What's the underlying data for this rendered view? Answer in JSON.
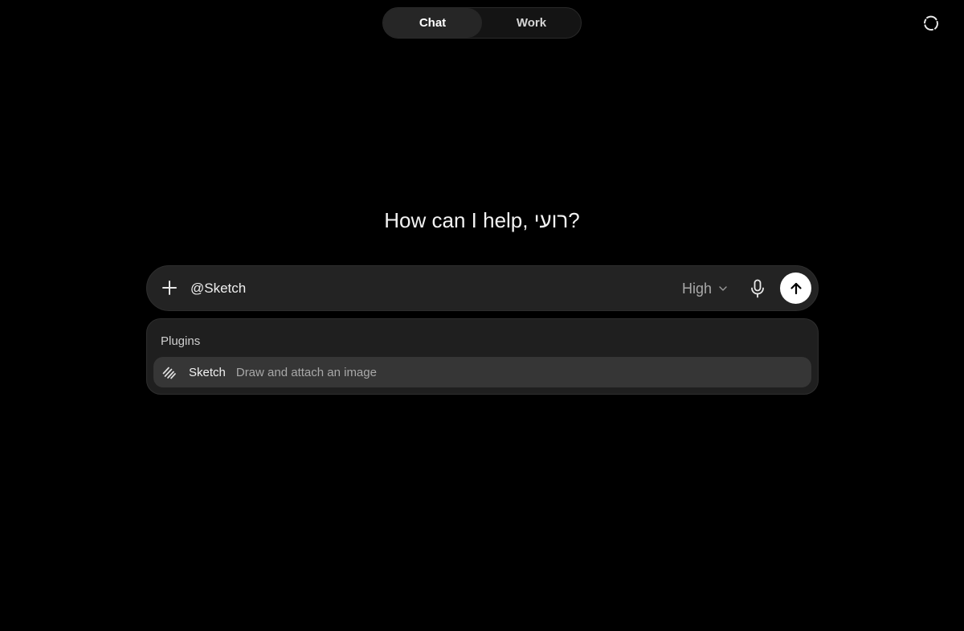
{
  "header": {
    "mode_tabs": [
      {
        "label": "Chat",
        "active": true
      },
      {
        "label": "Work",
        "active": false
      }
    ],
    "corner_icon": "refresh-loop-icon"
  },
  "greeting": "How can I help, רועי?",
  "composer": {
    "value": "@Sketch",
    "model_label": "High",
    "icons": {
      "attach": "plus-icon",
      "model_dropdown": "chevron-down-icon",
      "voice": "microphone-icon",
      "send": "arrow-up-icon"
    }
  },
  "plugins": {
    "heading": "Plugins",
    "items": [
      {
        "name": "Sketch",
        "description": "Draw and attach an image",
        "icon": "sketch-scribble-icon"
      }
    ]
  },
  "colors": {
    "background": "#000000",
    "surface": "#232323",
    "panel": "#1f1f1f",
    "highlight": "#363636",
    "send_button": "#ffffff"
  }
}
